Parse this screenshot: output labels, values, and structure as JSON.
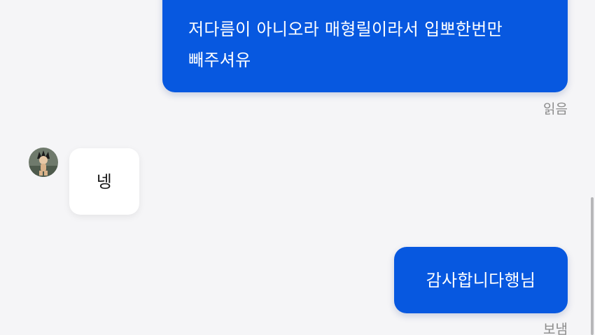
{
  "messages": [
    {
      "direction": "outgoing",
      "lines": [
        "저다름이 아니오라 매형릴이라서 입뽀한번만",
        "빼주셔유"
      ],
      "status": "읽음"
    },
    {
      "direction": "incoming",
      "text": "넹",
      "avatar_icon": "profile-avatar"
    },
    {
      "direction": "outgoing",
      "text": "감사합니다행님",
      "status": "보냄"
    }
  ],
  "colors": {
    "outgoing_bubble": "#0758e0",
    "incoming_bubble": "#ffffff",
    "background": "#f5f5f7",
    "status_text": "#8a8a8a"
  }
}
